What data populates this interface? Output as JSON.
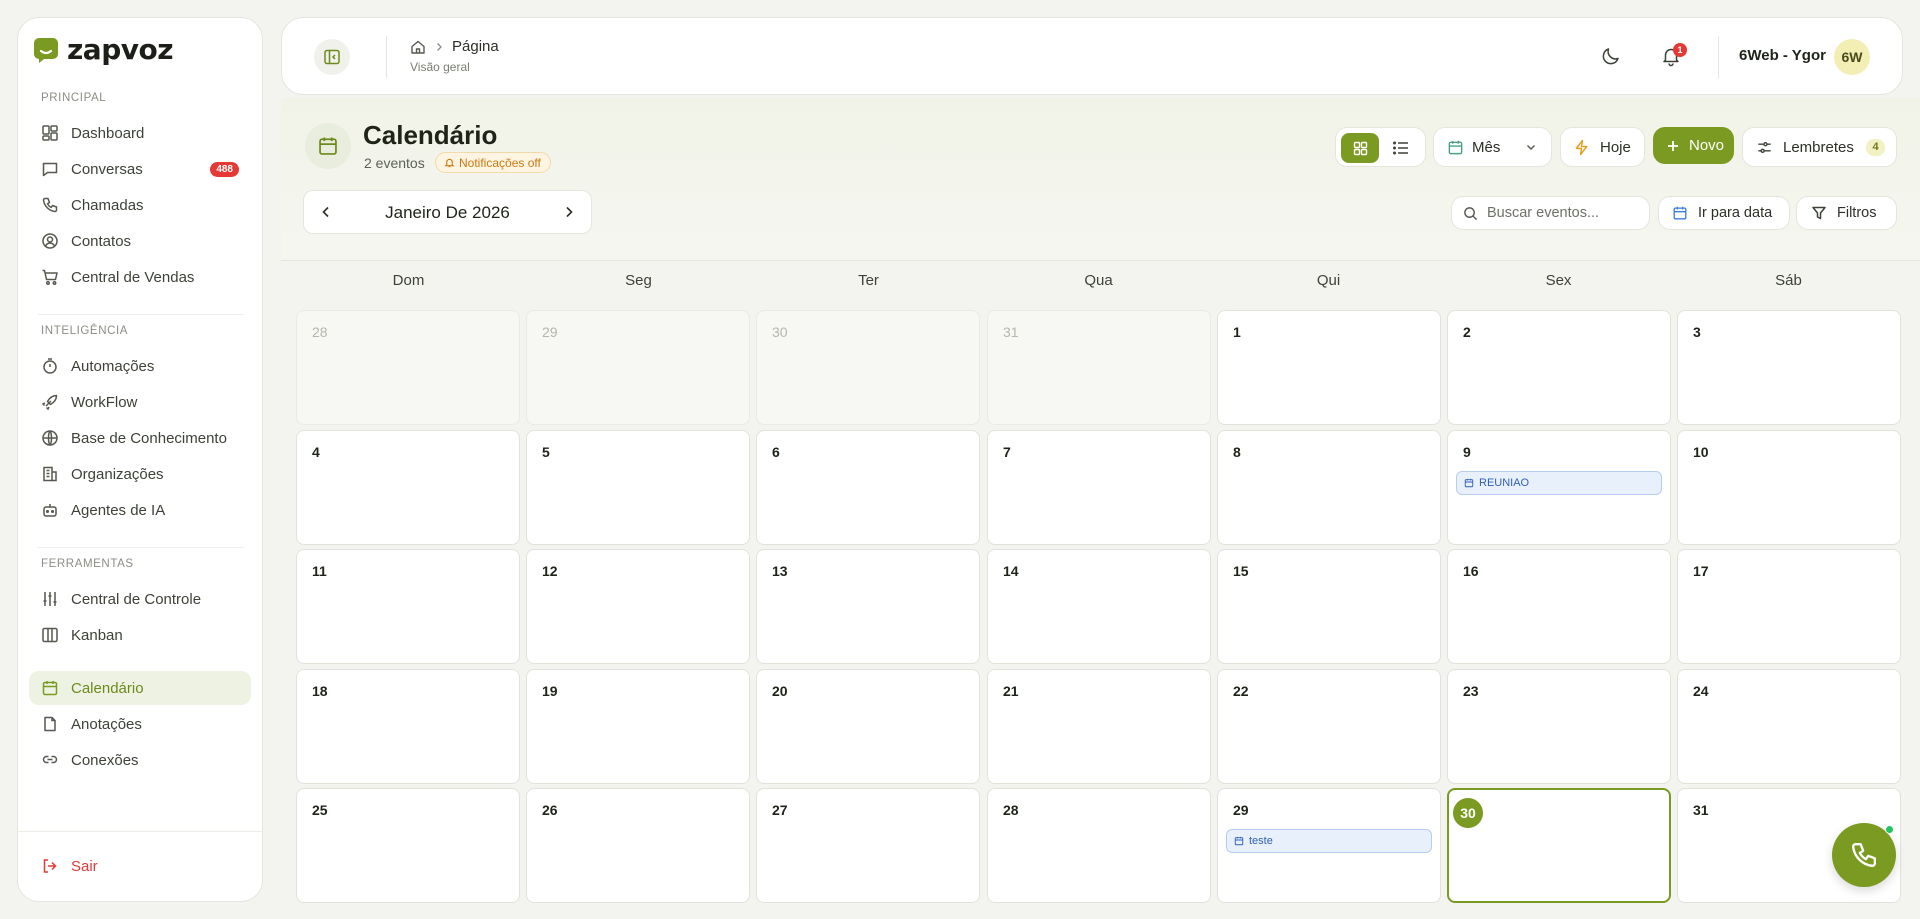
{
  "brand": {
    "name": "zapvoz",
    "accent": "#7a9a22"
  },
  "sidebar": {
    "sections": [
      {
        "label": "PRINCIPAL",
        "items": [
          {
            "label": "Dashboard",
            "icon": "dashboard-icon"
          },
          {
            "label": "Conversas",
            "icon": "chat-icon",
            "badge": "488"
          },
          {
            "label": "Chamadas",
            "icon": "phone-icon"
          },
          {
            "label": "Contatos",
            "icon": "contact-icon"
          },
          {
            "label": "Central de Vendas",
            "icon": "cart-icon"
          }
        ]
      },
      {
        "label": "INTELIGÊNCIA",
        "items": [
          {
            "label": "Automações",
            "icon": "timer-icon"
          },
          {
            "label": "WorkFlow",
            "icon": "rocket-icon"
          },
          {
            "label": "Base de Conhecimento",
            "icon": "globe-icon"
          },
          {
            "label": "Organizações",
            "icon": "building-icon"
          },
          {
            "label": "Agentes de IA",
            "icon": "bot-icon"
          }
        ]
      },
      {
        "label": "FERRAMENTAS",
        "items": [
          {
            "label": "Central de Controle",
            "icon": "sliders-icon"
          },
          {
            "label": "Kanban",
            "icon": "kanban-icon"
          },
          {
            "label": "Calendário",
            "icon": "calendar-icon",
            "active": true
          },
          {
            "label": "Anotações",
            "icon": "note-icon"
          },
          {
            "label": "Conexões",
            "icon": "link-icon"
          }
        ]
      }
    ],
    "logout": "Sair"
  },
  "header": {
    "breadcrumb": "Página",
    "subtitle": "Visão geral",
    "notifications": "1",
    "user_name": "6Web - Ygor",
    "avatar_initials": "6W"
  },
  "calendar": {
    "title": "Calendário",
    "event_count": "2 eventos",
    "notifications_status": "Notificações off",
    "view_select": "Mês",
    "today_label": "Hoje",
    "new_label": "Novo",
    "reminders_label": "Lembretes",
    "reminders_count": "4",
    "month_label": "Janeiro De 2026",
    "search_placeholder": "Buscar eventos...",
    "goto_label": "Ir para data",
    "filters_label": "Filtros",
    "weekdays": [
      "Dom",
      "Seg",
      "Ter",
      "Qua",
      "Qui",
      "Sex",
      "Sáb"
    ],
    "weeks": [
      [
        {
          "day": "28",
          "outside": true
        },
        {
          "day": "29",
          "outside": true
        },
        {
          "day": "30",
          "outside": true
        },
        {
          "day": "31",
          "outside": true
        },
        {
          "day": "1"
        },
        {
          "day": "2"
        },
        {
          "day": "3"
        }
      ],
      [
        {
          "day": "4"
        },
        {
          "day": "5"
        },
        {
          "day": "6"
        },
        {
          "day": "7"
        },
        {
          "day": "8"
        },
        {
          "day": "9",
          "events": [
            "REUNIAO"
          ]
        },
        {
          "day": "10"
        }
      ],
      [
        {
          "day": "11"
        },
        {
          "day": "12"
        },
        {
          "day": "13"
        },
        {
          "day": "14"
        },
        {
          "day": "15"
        },
        {
          "day": "16"
        },
        {
          "day": "17"
        }
      ],
      [
        {
          "day": "18"
        },
        {
          "day": "19"
        },
        {
          "day": "20"
        },
        {
          "day": "21"
        },
        {
          "day": "22"
        },
        {
          "day": "23"
        },
        {
          "day": "24"
        }
      ],
      [
        {
          "day": "25"
        },
        {
          "day": "26"
        },
        {
          "day": "27"
        },
        {
          "day": "28"
        },
        {
          "day": "29",
          "events": [
            "teste"
          ]
        },
        {
          "day": "30",
          "today": true
        },
        {
          "day": "31"
        }
      ]
    ]
  }
}
